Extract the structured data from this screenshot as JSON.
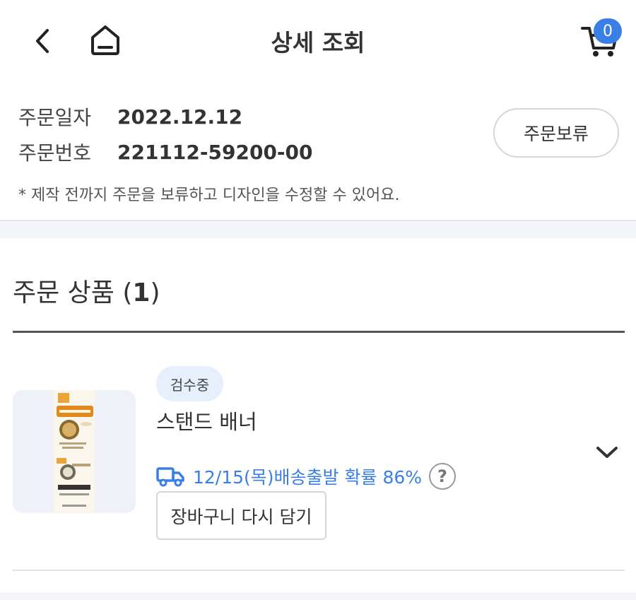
{
  "header": {
    "title": "상세 조회",
    "back_icon": "chevron-left-icon",
    "home_icon": "home-icon",
    "cart_icon": "cart-icon",
    "cart_count": "0"
  },
  "order": {
    "date_label": "주문일자",
    "date_value": "2022.12.12",
    "number_label": "주문번호",
    "number_value": "221112-59200-00",
    "hold_button": "주문보류",
    "notice": "* 제작 전까지 주문을 보류하고 디자인을 수정할 수 있어요."
  },
  "products": {
    "title": "주문 상품 (",
    "count": "1",
    "title_close": ")",
    "items": [
      {
        "status": "검수중",
        "name": "스탠드 배너",
        "delivery_icon": "truck-icon",
        "delivery_text": "12/15(목)배송출발 확률 86%",
        "help_icon": "question-circle-icon",
        "recart_button": "장바구니 다시 담기",
        "expand_icon": "chevron-down-icon"
      }
    ]
  },
  "colors": {
    "accent": "#3a7fe6",
    "chip_bg": "#e6f0fc",
    "section_bg": "#f3f5f9"
  }
}
